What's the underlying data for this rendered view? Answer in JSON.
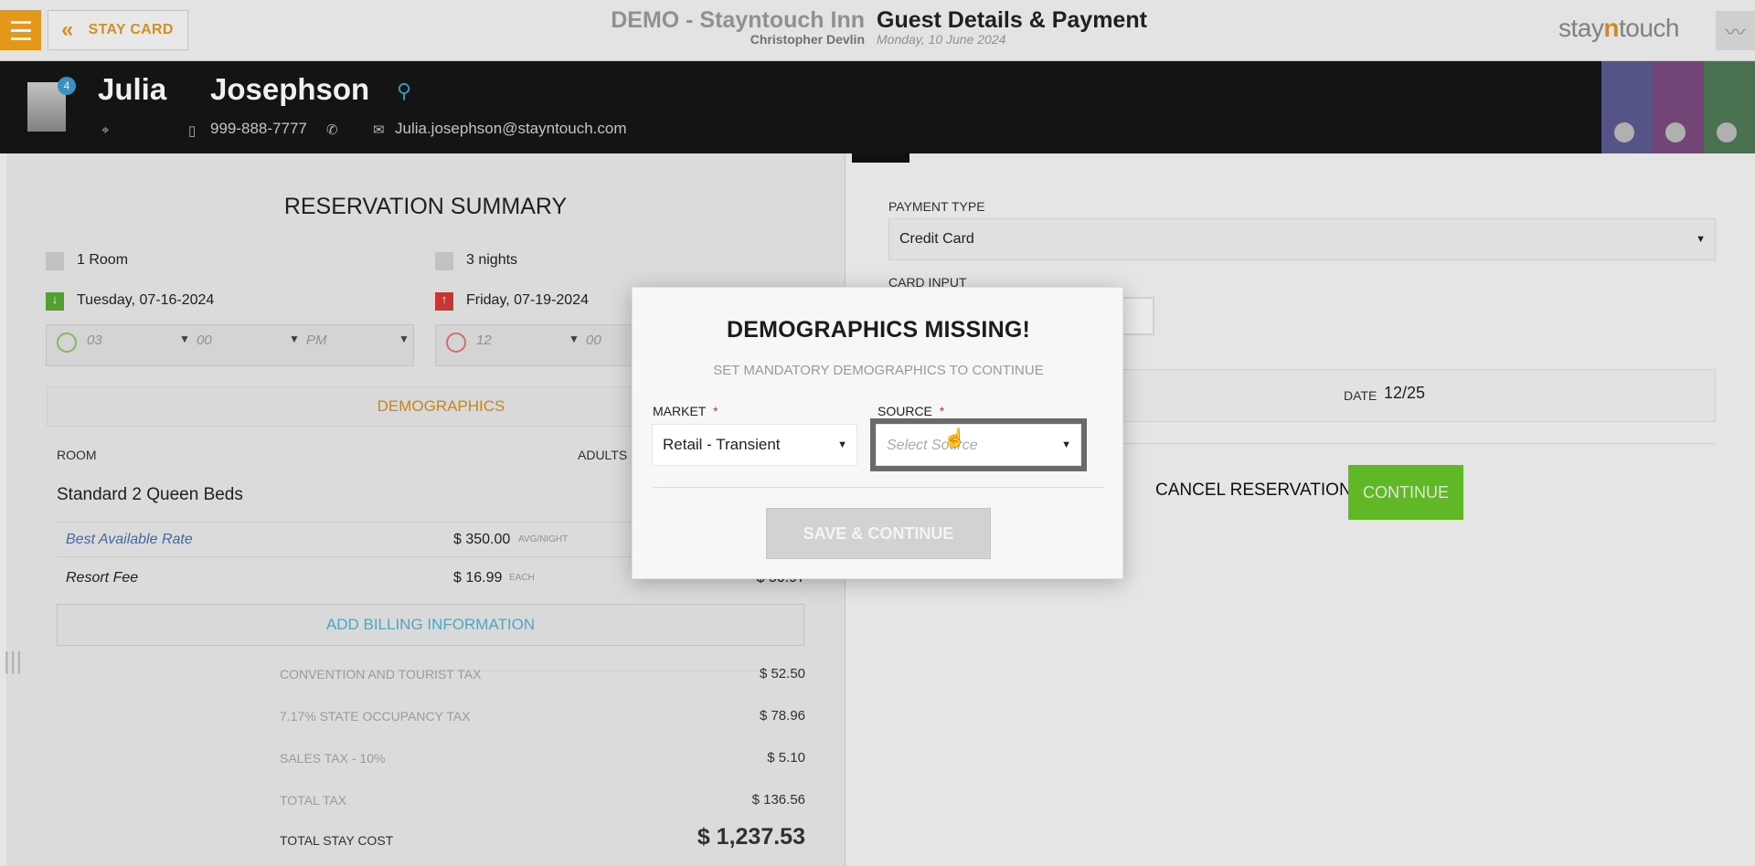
{
  "topbar": {
    "stay_card_label": "STAY CARD",
    "hotel_name": "DEMO - Stayntouch Inn",
    "user_name": "Christopher Devlin",
    "page_title": "Guest Details & Payment",
    "page_date": "Monday, 10 June 2024",
    "logo_part1": "stay",
    "logo_part2": "n",
    "logo_part3": "touch"
  },
  "guest": {
    "first_name": "Julia",
    "last_name": "Josephson",
    "badge": "4",
    "phone": "999-888-7777",
    "email": "Julia.josephson@stayntouch.com",
    "shortcut_colors": [
      "#5a5a8f",
      "#7a4a7e",
      "#4f7a55"
    ]
  },
  "summary": {
    "title": "RESERVATION SUMMARY",
    "rooms": "1 Room",
    "nights": "3 nights",
    "arrival": "Tuesday, 07-16-2024",
    "departure": "Friday, 07-19-2024",
    "arr_hour": "03",
    "arr_min": "00",
    "arr_ampm": "PM",
    "dep_hour": "12",
    "dep_min": "00",
    "demographics_tab": "DEMOGRAPHICS",
    "room_header": "ROOM",
    "adults_header": "ADULTS",
    "room_type": "Standard 2 Queen Beds",
    "rate_name": "Best Available Rate",
    "rate_amount": "$ 350.00",
    "rate_unit": "AVG/NIGHT",
    "fee_name": "Resort Fee",
    "fee_amount": "$ 16.99",
    "fee_unit": "EACH",
    "fee_total": "$ 50.97",
    "add_billing": "ADD BILLING INFORMATION",
    "taxes": [
      {
        "label": "CONVENTION AND TOURIST TAX",
        "value": "$ 52.50"
      },
      {
        "label": "7.17% STATE OCCUPANCY TAX",
        "value": "$ 78.96"
      },
      {
        "label": "SALES TAX - 10%",
        "value": "$ 5.10"
      },
      {
        "label": "TOTAL TAX",
        "value": "$ 136.56"
      }
    ],
    "total_label": "TOTAL STAY COST",
    "total_value": "$ 1,237.53"
  },
  "payment": {
    "type_label": "PAYMENT TYPE",
    "type_value": "Credit Card",
    "card_input_label": "CARD INPUT",
    "date_label": "DATE",
    "date_value": "12/25",
    "cancel_label": "CANCEL RESERVATION",
    "continue_label": "CONTINUE"
  },
  "modal": {
    "title": "DEMOGRAPHICS MISSING!",
    "subtitle": "SET MANDATORY DEMOGRAPHICS TO CONTINUE",
    "market_label": "MARKET",
    "market_value": "Retail - Transient",
    "source_label": "SOURCE",
    "source_placeholder": "Select Source",
    "required_mark": "*",
    "save_label": "SAVE & CONTINUE"
  }
}
